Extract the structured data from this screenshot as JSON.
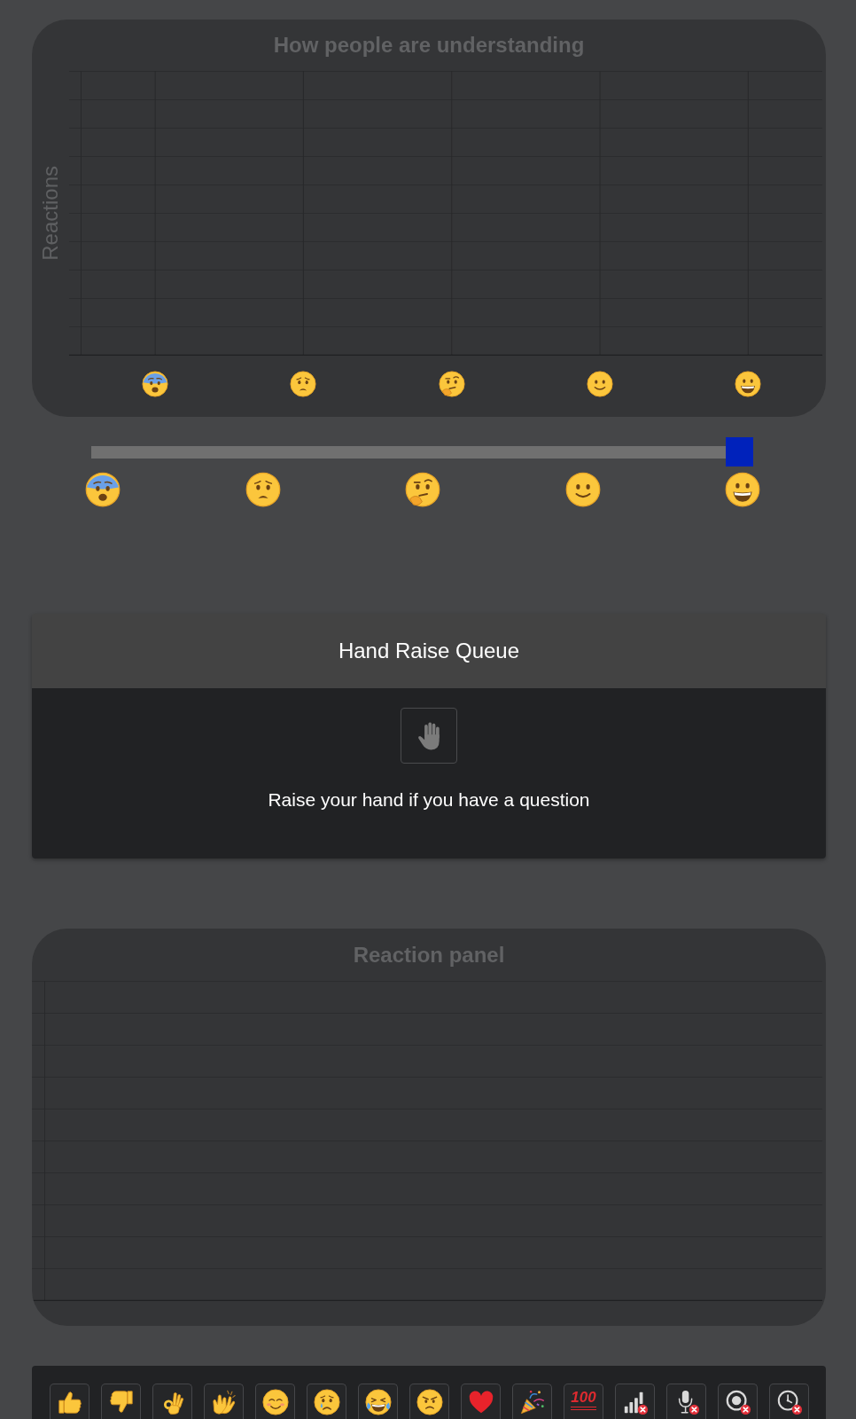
{
  "understanding_chart": {
    "title": "How people are understanding",
    "ylabel": "Reactions",
    "x_labels": [
      {
        "kind": "fearful"
      },
      {
        "kind": "worried"
      },
      {
        "kind": "thinking"
      },
      {
        "kind": "slight-smile"
      },
      {
        "kind": "grinning"
      }
    ]
  },
  "understanding_slider": {
    "level": 1,
    "marks": [
      {
        "kind": "fearful"
      },
      {
        "kind": "worried"
      },
      {
        "kind": "thinking"
      },
      {
        "kind": "slight-smile"
      },
      {
        "kind": "grinning"
      }
    ]
  },
  "hand_raise_queue": {
    "title": "Hand Raise Queue",
    "prompt": "Raise your hand if you have a question"
  },
  "reaction_panel": {
    "title": "Reaction panel"
  },
  "reaction_toolbar": [
    {
      "kind": "thumbs-up"
    },
    {
      "kind": "thumbs-down"
    },
    {
      "kind": "ok-hand"
    },
    {
      "kind": "clapping"
    },
    {
      "kind": "blushing"
    },
    {
      "kind": "crying"
    },
    {
      "kind": "laughing"
    },
    {
      "kind": "angry"
    },
    {
      "kind": "heart"
    },
    {
      "kind": "party"
    },
    {
      "kind": "hundred",
      "label": "100"
    },
    {
      "kind": "signal-off"
    },
    {
      "kind": "mic-off"
    },
    {
      "kind": "record-off"
    },
    {
      "kind": "clock-off"
    }
  ]
}
